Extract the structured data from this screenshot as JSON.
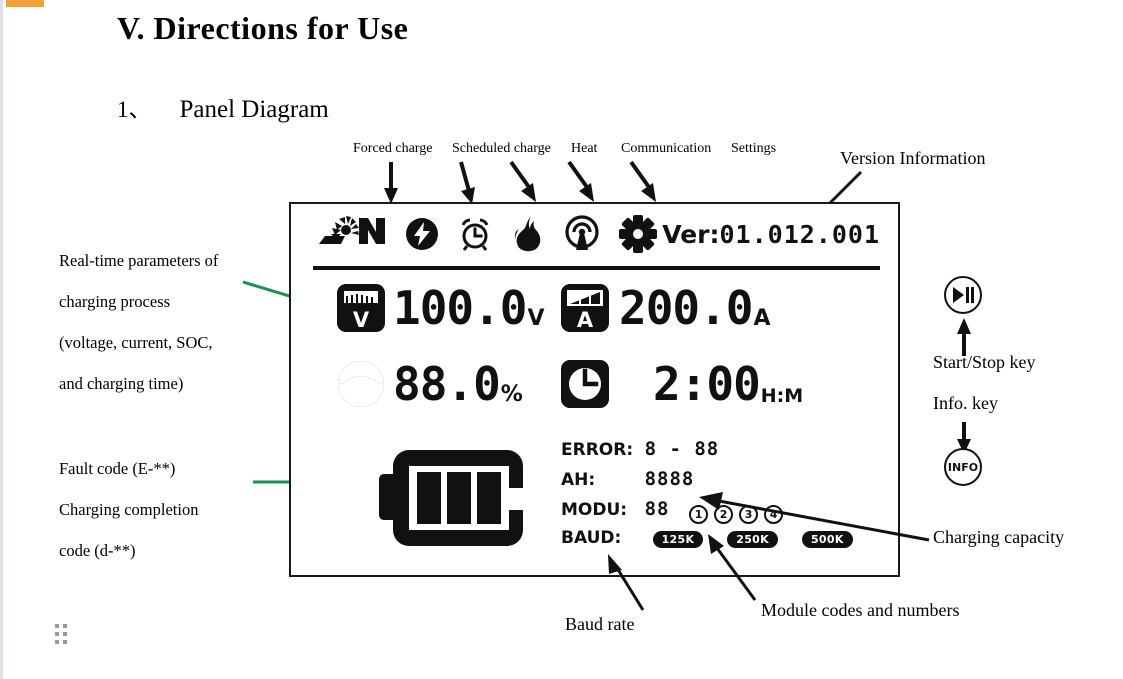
{
  "document": {
    "heading": "V. Directions for Use",
    "section_number": "1、",
    "section_title": "Panel Diagram"
  },
  "top_callouts": [
    {
      "label": "Forced charge"
    },
    {
      "label": "Scheduled charge"
    },
    {
      "label": "Heat"
    },
    {
      "label": "Communication"
    },
    {
      "label": "Settings"
    },
    {
      "label": "Version Information"
    }
  ],
  "left_callouts": {
    "realtime": [
      "Real-time parameters of",
      "charging process",
      "(voltage, current, SOC,",
      "and charging time)"
    ],
    "fault": [
      "Fault code (E-**)",
      "Charging completion",
      "code (d-**)"
    ]
  },
  "right_callouts": {
    "start_stop": "Start/Stop key",
    "info": "Info. key",
    "capacity": "Charging capacity"
  },
  "bottom_callouts": {
    "baud": "Baud rate",
    "module": "Module codes and numbers"
  },
  "panel": {
    "brand_logo": "sn-logo",
    "status_icons": [
      {
        "name": "lightning-bolt-icon",
        "tooltip": "Forced charge"
      },
      {
        "name": "alarm-clock-icon",
        "tooltip": "Scheduled charge"
      },
      {
        "name": "flame-icon",
        "tooltip": "Heat"
      },
      {
        "name": "antenna-signal-icon",
        "tooltip": "Communication"
      },
      {
        "name": "gear-icon",
        "tooltip": "Settings"
      }
    ],
    "version": {
      "label": "Ver:",
      "value": "01.012.001"
    },
    "readouts": [
      {
        "id": "voltage",
        "icon": "voltmeter-icon",
        "value": "100.0",
        "unit": "V"
      },
      {
        "id": "current",
        "icon": "ammeter-icon",
        "value": "200.0",
        "unit": "A"
      },
      {
        "id": "soc",
        "icon": "soc-gauge-icon",
        "value": "88.0",
        "unit": "%"
      },
      {
        "id": "time",
        "icon": "clock-icon",
        "value": "2:00",
        "unit": "H:M"
      }
    ],
    "battery_icon": "battery-three-bars-icon",
    "status_rows": [
      {
        "key": "ERROR:",
        "value": "8 - 88"
      },
      {
        "key": "AH:",
        "value": "8888"
      },
      {
        "key": "MODU:",
        "value": "88",
        "modules": [
          "1",
          "2",
          "3",
          "4"
        ]
      },
      {
        "key": "BAUD:",
        "value": "",
        "bauds": [
          "125K",
          "250K",
          "500K"
        ]
      }
    ]
  },
  "keys": [
    {
      "name": "start-stop-key",
      "glyph": "play-pause-icon"
    },
    {
      "name": "info-key",
      "glyph": "INFO"
    }
  ],
  "colors": {
    "accent_orange": "#f0a23a",
    "annotation_green": "#17924f",
    "ink": "#111111"
  }
}
